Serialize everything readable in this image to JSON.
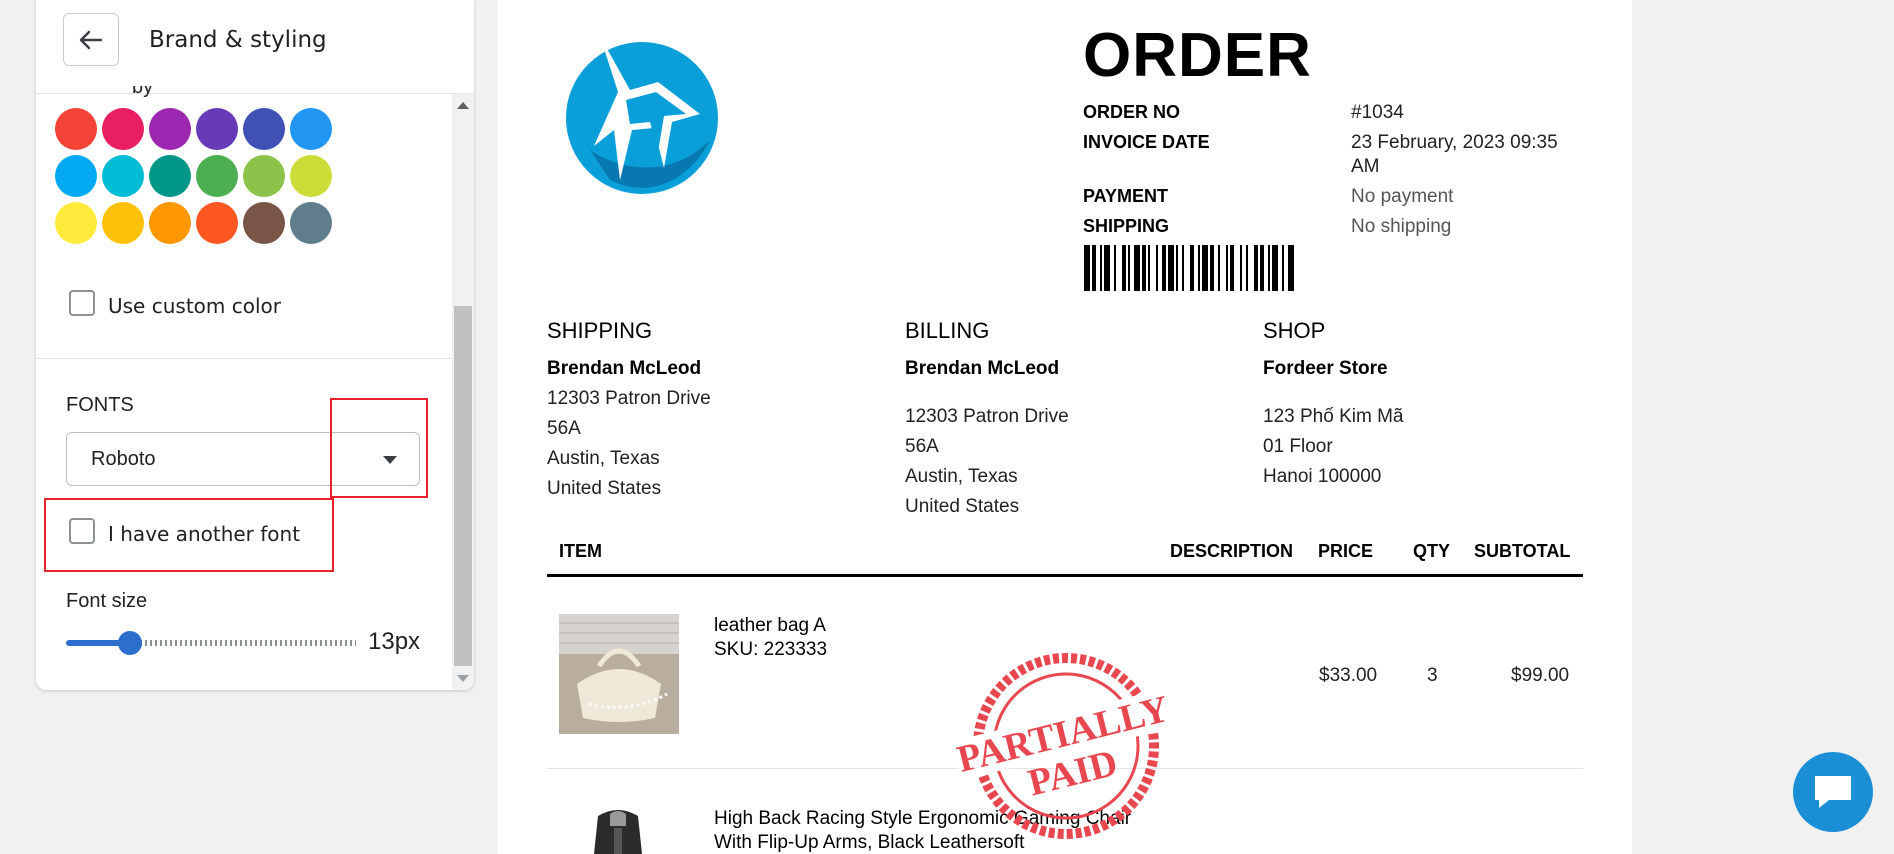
{
  "panel": {
    "title": "Brand & styling",
    "partial_heading": "by",
    "colors": [
      "#f44336",
      "#e91e63",
      "#9c27b0",
      "#673ab7",
      "#3f51b5",
      "#2196f3",
      "#03a9f4",
      "#00bcd4",
      "#009688",
      "#4caf50",
      "#8bc34a",
      "#cddc39",
      "#ffeb3b",
      "#ffc107",
      "#ff9800",
      "#ff5722",
      "#795548",
      "#607d8b"
    ],
    "custom_color_label": "Use custom color",
    "fonts_heading": "FONTS",
    "font_value": "Roboto",
    "another_font_label": "I have another font",
    "font_size_label": "Font size",
    "font_size_value": "13px",
    "font_size_slider_fraction": 0.22
  },
  "invoice": {
    "title": "ORDER",
    "meta": [
      {
        "label": "ORDER NO",
        "value": "#1034"
      },
      {
        "label": "INVOICE DATE",
        "value": "23 February, 2023 09:35",
        "value2": "AM"
      },
      {
        "label": "PAYMENT",
        "value": "No payment"
      },
      {
        "label": "SHIPPING",
        "value": "No shipping"
      }
    ],
    "shipping": {
      "heading": "SHIPPING",
      "name": "Brendan McLeod",
      "lines": [
        "12303 Patron Drive",
        "56A",
        "Austin, Texas",
        "United States"
      ]
    },
    "billing": {
      "heading": "BILLING",
      "name": "Brendan McLeod",
      "lines": [
        "12303 Patron Drive",
        "56A",
        "Austin, Texas",
        "United States"
      ]
    },
    "shop": {
      "heading": "SHOP",
      "name": "Fordeer Store",
      "lines": [
        "123 Phố Kim Mã",
        "01 Floor",
        "Hanoi 100000"
      ]
    },
    "table_headers": {
      "item": "ITEM",
      "description": "DESCRIPTION",
      "price": "PRICE",
      "qty": "QTY",
      "subtotal": "SUBTOTAL"
    },
    "items": [
      {
        "name": "leather bag A",
        "sku": "SKU: 223333",
        "price": "$33.00",
        "qty": "3",
        "subtotal": "$99.00"
      },
      {
        "name": "High Back Racing Style Ergonomic Gaming Chair",
        "name2": "With Flip-Up Arms, Black Leathersoft"
      }
    ],
    "stamp": {
      "line1": "PARTIALLY",
      "line2": "PAID",
      "color": "#e8474f"
    }
  },
  "colors": {
    "accent": "#2c6ecb",
    "highlight": "#e8222c",
    "chat": "#1a8fd6",
    "logo": "#0a9fd8"
  }
}
